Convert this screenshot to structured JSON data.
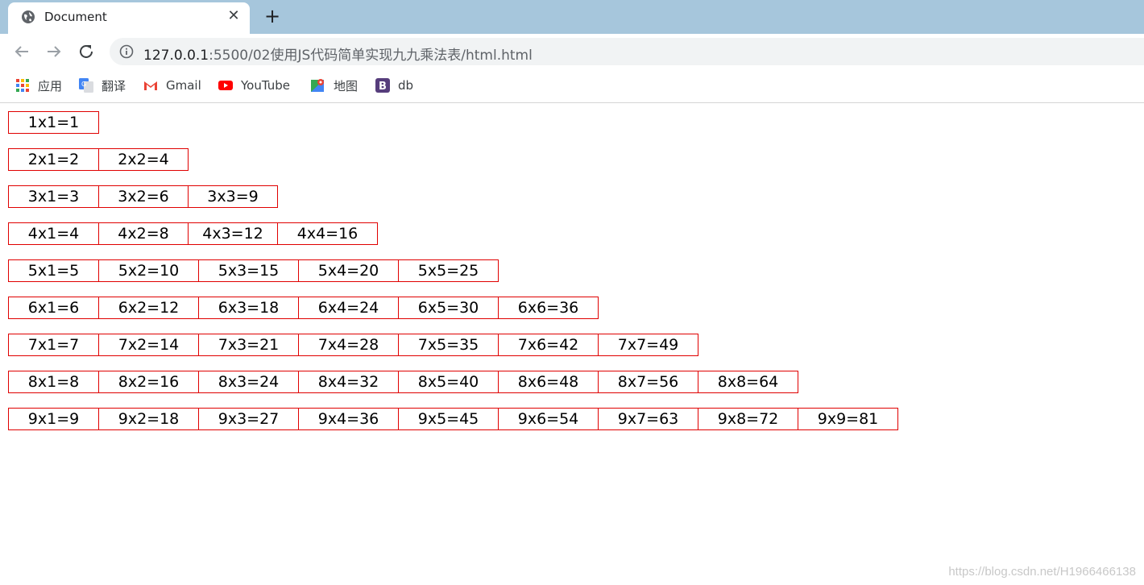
{
  "browser": {
    "tab": {
      "title": "Document",
      "close_glyph": "✕"
    },
    "new_tab_glyph": "+",
    "url": {
      "host": "127.0.0.1",
      "path": ":5500/02使用JS代码简单实现九九乘法表/html.html"
    },
    "bookmarks": [
      {
        "label": "应用",
        "icon": "apps-grid-icon"
      },
      {
        "label": "翻译",
        "icon": "google-translate-icon"
      },
      {
        "label": "Gmail",
        "icon": "gmail-icon"
      },
      {
        "label": "YouTube",
        "icon": "youtube-icon"
      },
      {
        "label": "地图",
        "icon": "maps-icon"
      },
      {
        "label": "db",
        "icon": "bootstrap-icon"
      }
    ]
  },
  "table": {
    "border_color": "#e00000",
    "rows": [
      [
        "1x1=1"
      ],
      [
        "2x1=2",
        "2x2=4"
      ],
      [
        "3x1=3",
        "3x2=6",
        "3x3=9"
      ],
      [
        "4x1=4",
        "4x2=8",
        "4x3=12",
        "4x4=16"
      ],
      [
        "5x1=5",
        "5x2=10",
        "5x3=15",
        "5x4=20",
        "5x5=25"
      ],
      [
        "6x1=6",
        "6x2=12",
        "6x3=18",
        "6x4=24",
        "6x5=30",
        "6x6=36"
      ],
      [
        "7x1=7",
        "7x2=14",
        "7x3=21",
        "7x4=28",
        "7x5=35",
        "7x6=42",
        "7x7=49"
      ],
      [
        "8x1=8",
        "8x2=16",
        "8x3=24",
        "8x4=32",
        "8x5=40",
        "8x6=48",
        "8x7=56",
        "8x8=64"
      ],
      [
        "9x1=9",
        "9x2=18",
        "9x3=27",
        "9x4=36",
        "9x5=45",
        "9x6=54",
        "9x7=63",
        "9x8=72",
        "9x9=81"
      ]
    ]
  },
  "watermark": "https://blog.csdn.net/H1966466138"
}
